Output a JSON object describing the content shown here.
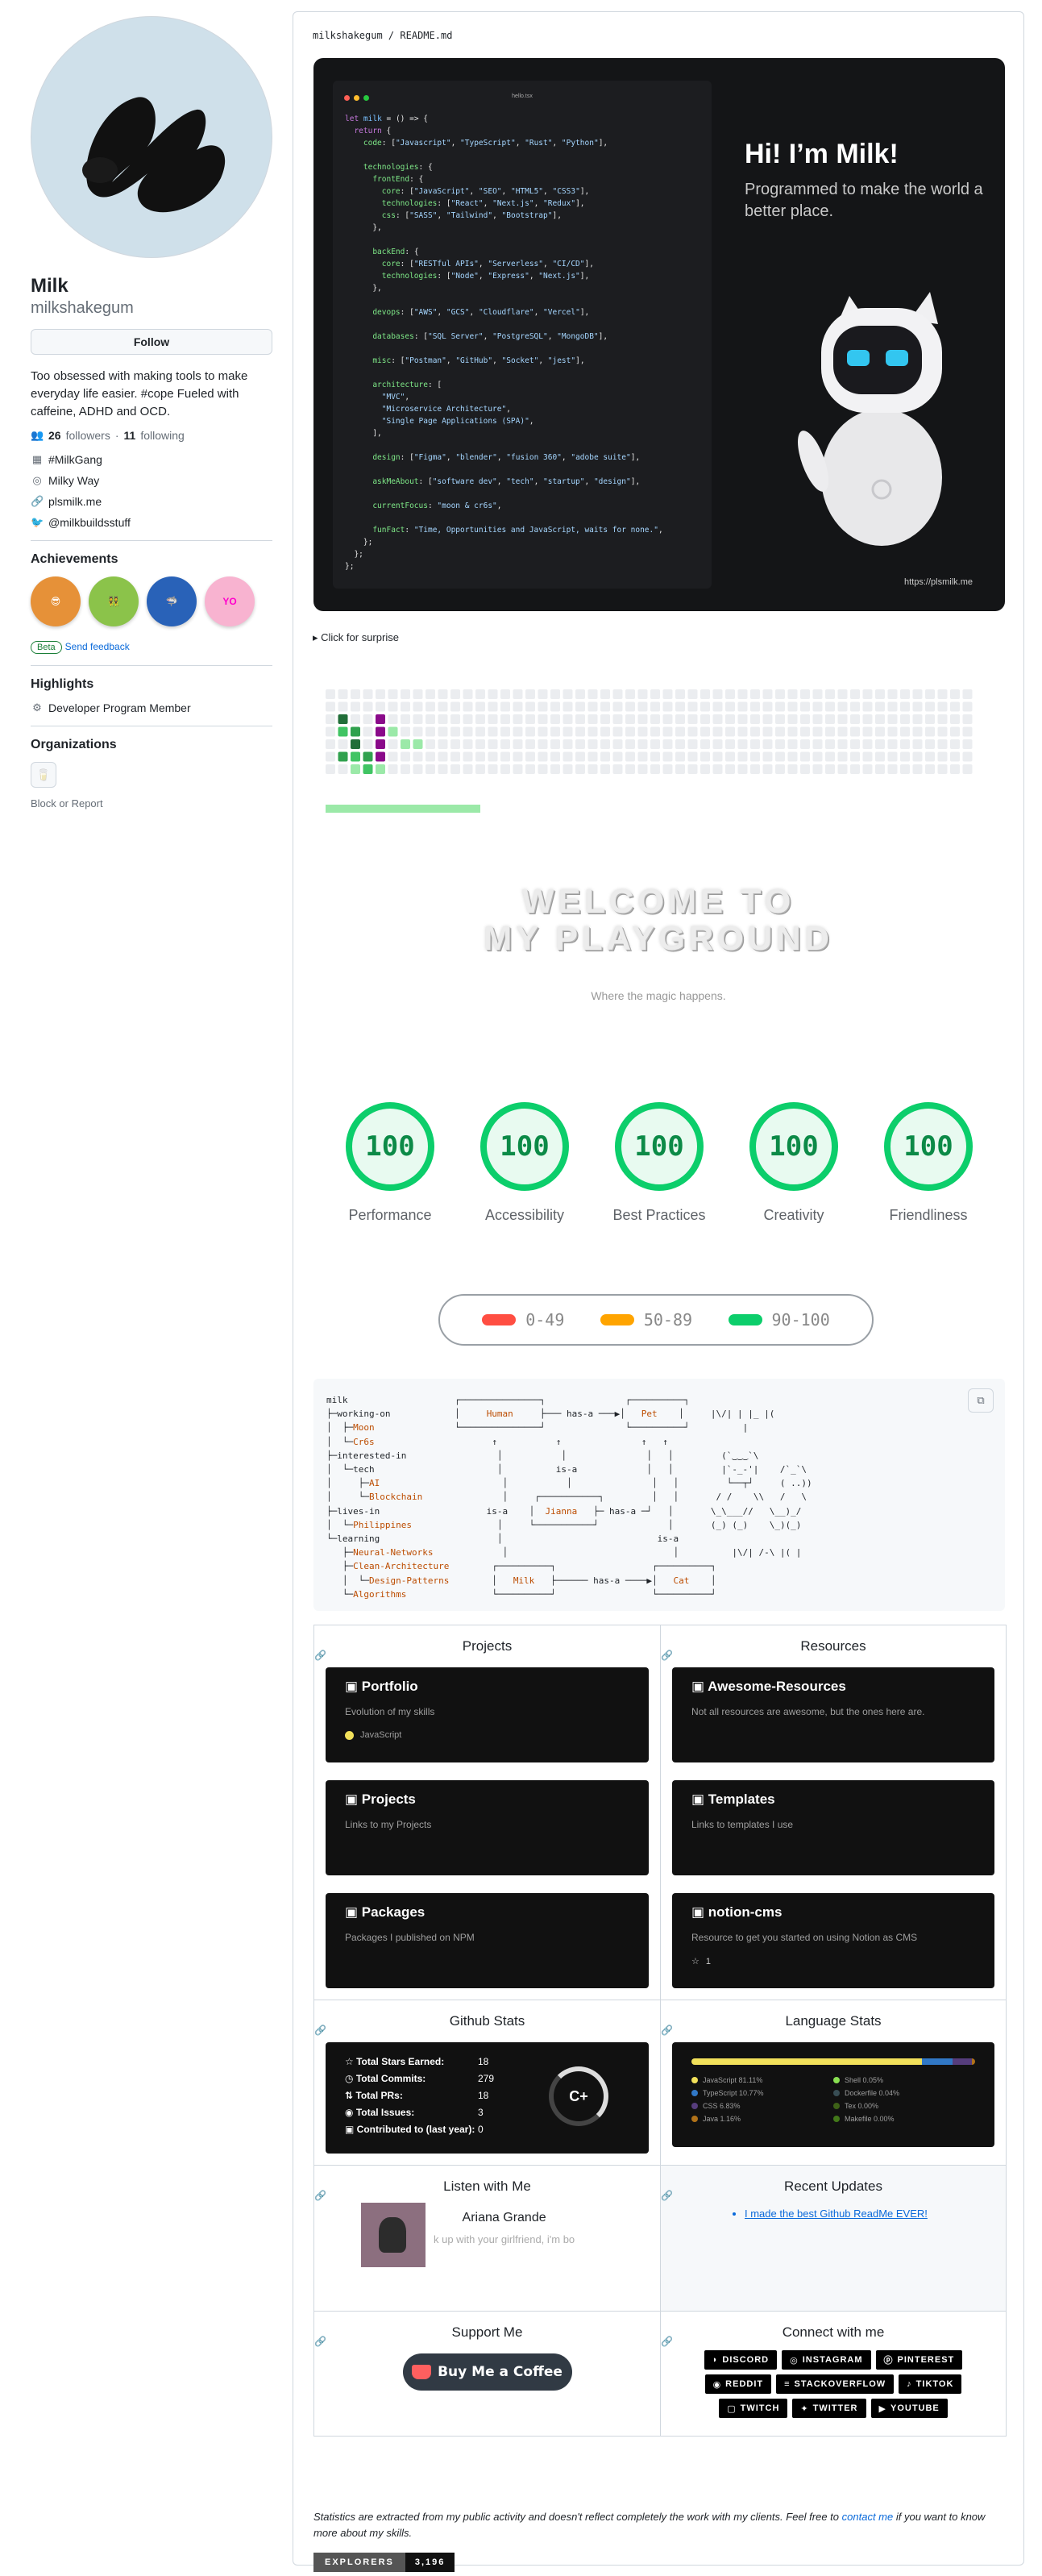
{
  "profile": {
    "name": "Milk",
    "username": "milkshakegum",
    "follow_label": "Follow",
    "bio": "Too obsessed with making tools to make everyday life easier. #cope Fueled with caffeine, ADHD and OCD.",
    "followers": "26",
    "followers_label": "followers",
    "following": "11",
    "following_label": "following",
    "org": "#MilkGang",
    "location": "Milky Way",
    "website": "plsmilk.me",
    "twitter": "@milkbuildsstuff"
  },
  "achievements": {
    "title": "Achievements",
    "beta": "Beta",
    "feedback": "Send feedback"
  },
  "highlights": {
    "title": "Highlights",
    "item": "Developer Program Member"
  },
  "organizations": {
    "title": "Organizations",
    "block": "Block or Report"
  },
  "readme": {
    "owner": "milkshakegum",
    "file": "README.md"
  },
  "hero": {
    "window_title": "hello.tsx",
    "title": "Hi! I’m Milk!",
    "subtitle": "Programmed to make the world a better place.",
    "url": "https://plsmilk.me"
  },
  "surprise": "Click for surprise",
  "welcome": {
    "line1": "WELCOME TO",
    "line2": "MY PLAYGROUND",
    "tagline": "Where the magic happens."
  },
  "gauges": [
    {
      "score": "100",
      "label": "Performance"
    },
    {
      "score": "100",
      "label": "Accessibility"
    },
    {
      "score": "100",
      "label": "Best Practices"
    },
    {
      "score": "100",
      "label": "Creativity"
    },
    {
      "score": "100",
      "label": "Friendliness"
    }
  ],
  "score_legend": [
    {
      "range": "0-49",
      "color": "#ff4e42"
    },
    {
      "range": "50-89",
      "color": "#ffa400"
    },
    {
      "range": "90-100",
      "color": "#0cce6b"
    }
  ],
  "projects": {
    "title": "Projects",
    "cards": [
      {
        "name": "Portfolio",
        "desc": "Evolution of my skills",
        "lang": "JavaScript"
      },
      {
        "name": "Projects",
        "desc": "Links to my Projects"
      },
      {
        "name": "Packages",
        "desc": "Packages I published on NPM"
      }
    ]
  },
  "resources": {
    "title": "Resources",
    "cards": [
      {
        "name": "Awesome-Resources",
        "desc": "Not all resources are awesome, but the ones here are."
      },
      {
        "name": "Templates",
        "desc": "Links to templates I use"
      },
      {
        "name": "notion-cms",
        "desc": "Resource to get you started on using Notion as CMS",
        "stars": "1"
      }
    ]
  },
  "github_stats": {
    "title": "Github Stats",
    "rows": [
      {
        "label": "Total Stars Earned:",
        "value": "18"
      },
      {
        "label": "Total Commits:",
        "value": "279"
      },
      {
        "label": "Total PRs:",
        "value": "18"
      },
      {
        "label": "Total Issues:",
        "value": "3"
      },
      {
        "label": "Contributed to (last year):",
        "value": "0"
      }
    ],
    "grade": "C+"
  },
  "language_stats": {
    "title": "Language Stats",
    "langs": [
      {
        "name": "JavaScript 81.11%",
        "color": "#f1e05a",
        "pct": 81.11
      },
      {
        "name": "Shell 0.05%",
        "color": "#89e051",
        "pct": 0.05
      },
      {
        "name": "TypeScript 10.77%",
        "color": "#3178c6",
        "pct": 10.77
      },
      {
        "name": "Dockerfile 0.04%",
        "color": "#384d54",
        "pct": 0.04
      },
      {
        "name": "CSS 6.83%",
        "color": "#563d7c",
        "pct": 6.83
      },
      {
        "name": "Tex 0.00%",
        "color": "#3d6117",
        "pct": 0
      },
      {
        "name": "Java 1.16%",
        "color": "#b07219",
        "pct": 1.16
      },
      {
        "name": "Makefile 0.00%",
        "color": "#427819",
        "pct": 0
      }
    ]
  },
  "spotify": {
    "title": "Listen with Me",
    "artist": "Ariana Grande",
    "track": "k up with your girlfriend, i'm bo"
  },
  "updates": {
    "title": "Recent Updates",
    "item": "I made the best Github ReadMe EVER!"
  },
  "support": {
    "title": "Support Me",
    "button": "Buy Me a Coffee"
  },
  "connect": {
    "title": "Connect with me",
    "links": [
      "DISCORD",
      "INSTAGRAM",
      "PINTEREST",
      "REDDIT",
      "STACKOVERFLOW",
      "TIKTOK",
      "TWITCH",
      "TWITTER",
      "YOUTUBE"
    ]
  },
  "footnote": {
    "text": "Statistics are extracted from my public activity and doesn't reflect completely the work with my clients. Feel free to",
    "link": "contact me",
    "tail": "if you want to know more about my skills."
  },
  "counter": {
    "label": "EXPLORERS",
    "value": "3,196"
  }
}
